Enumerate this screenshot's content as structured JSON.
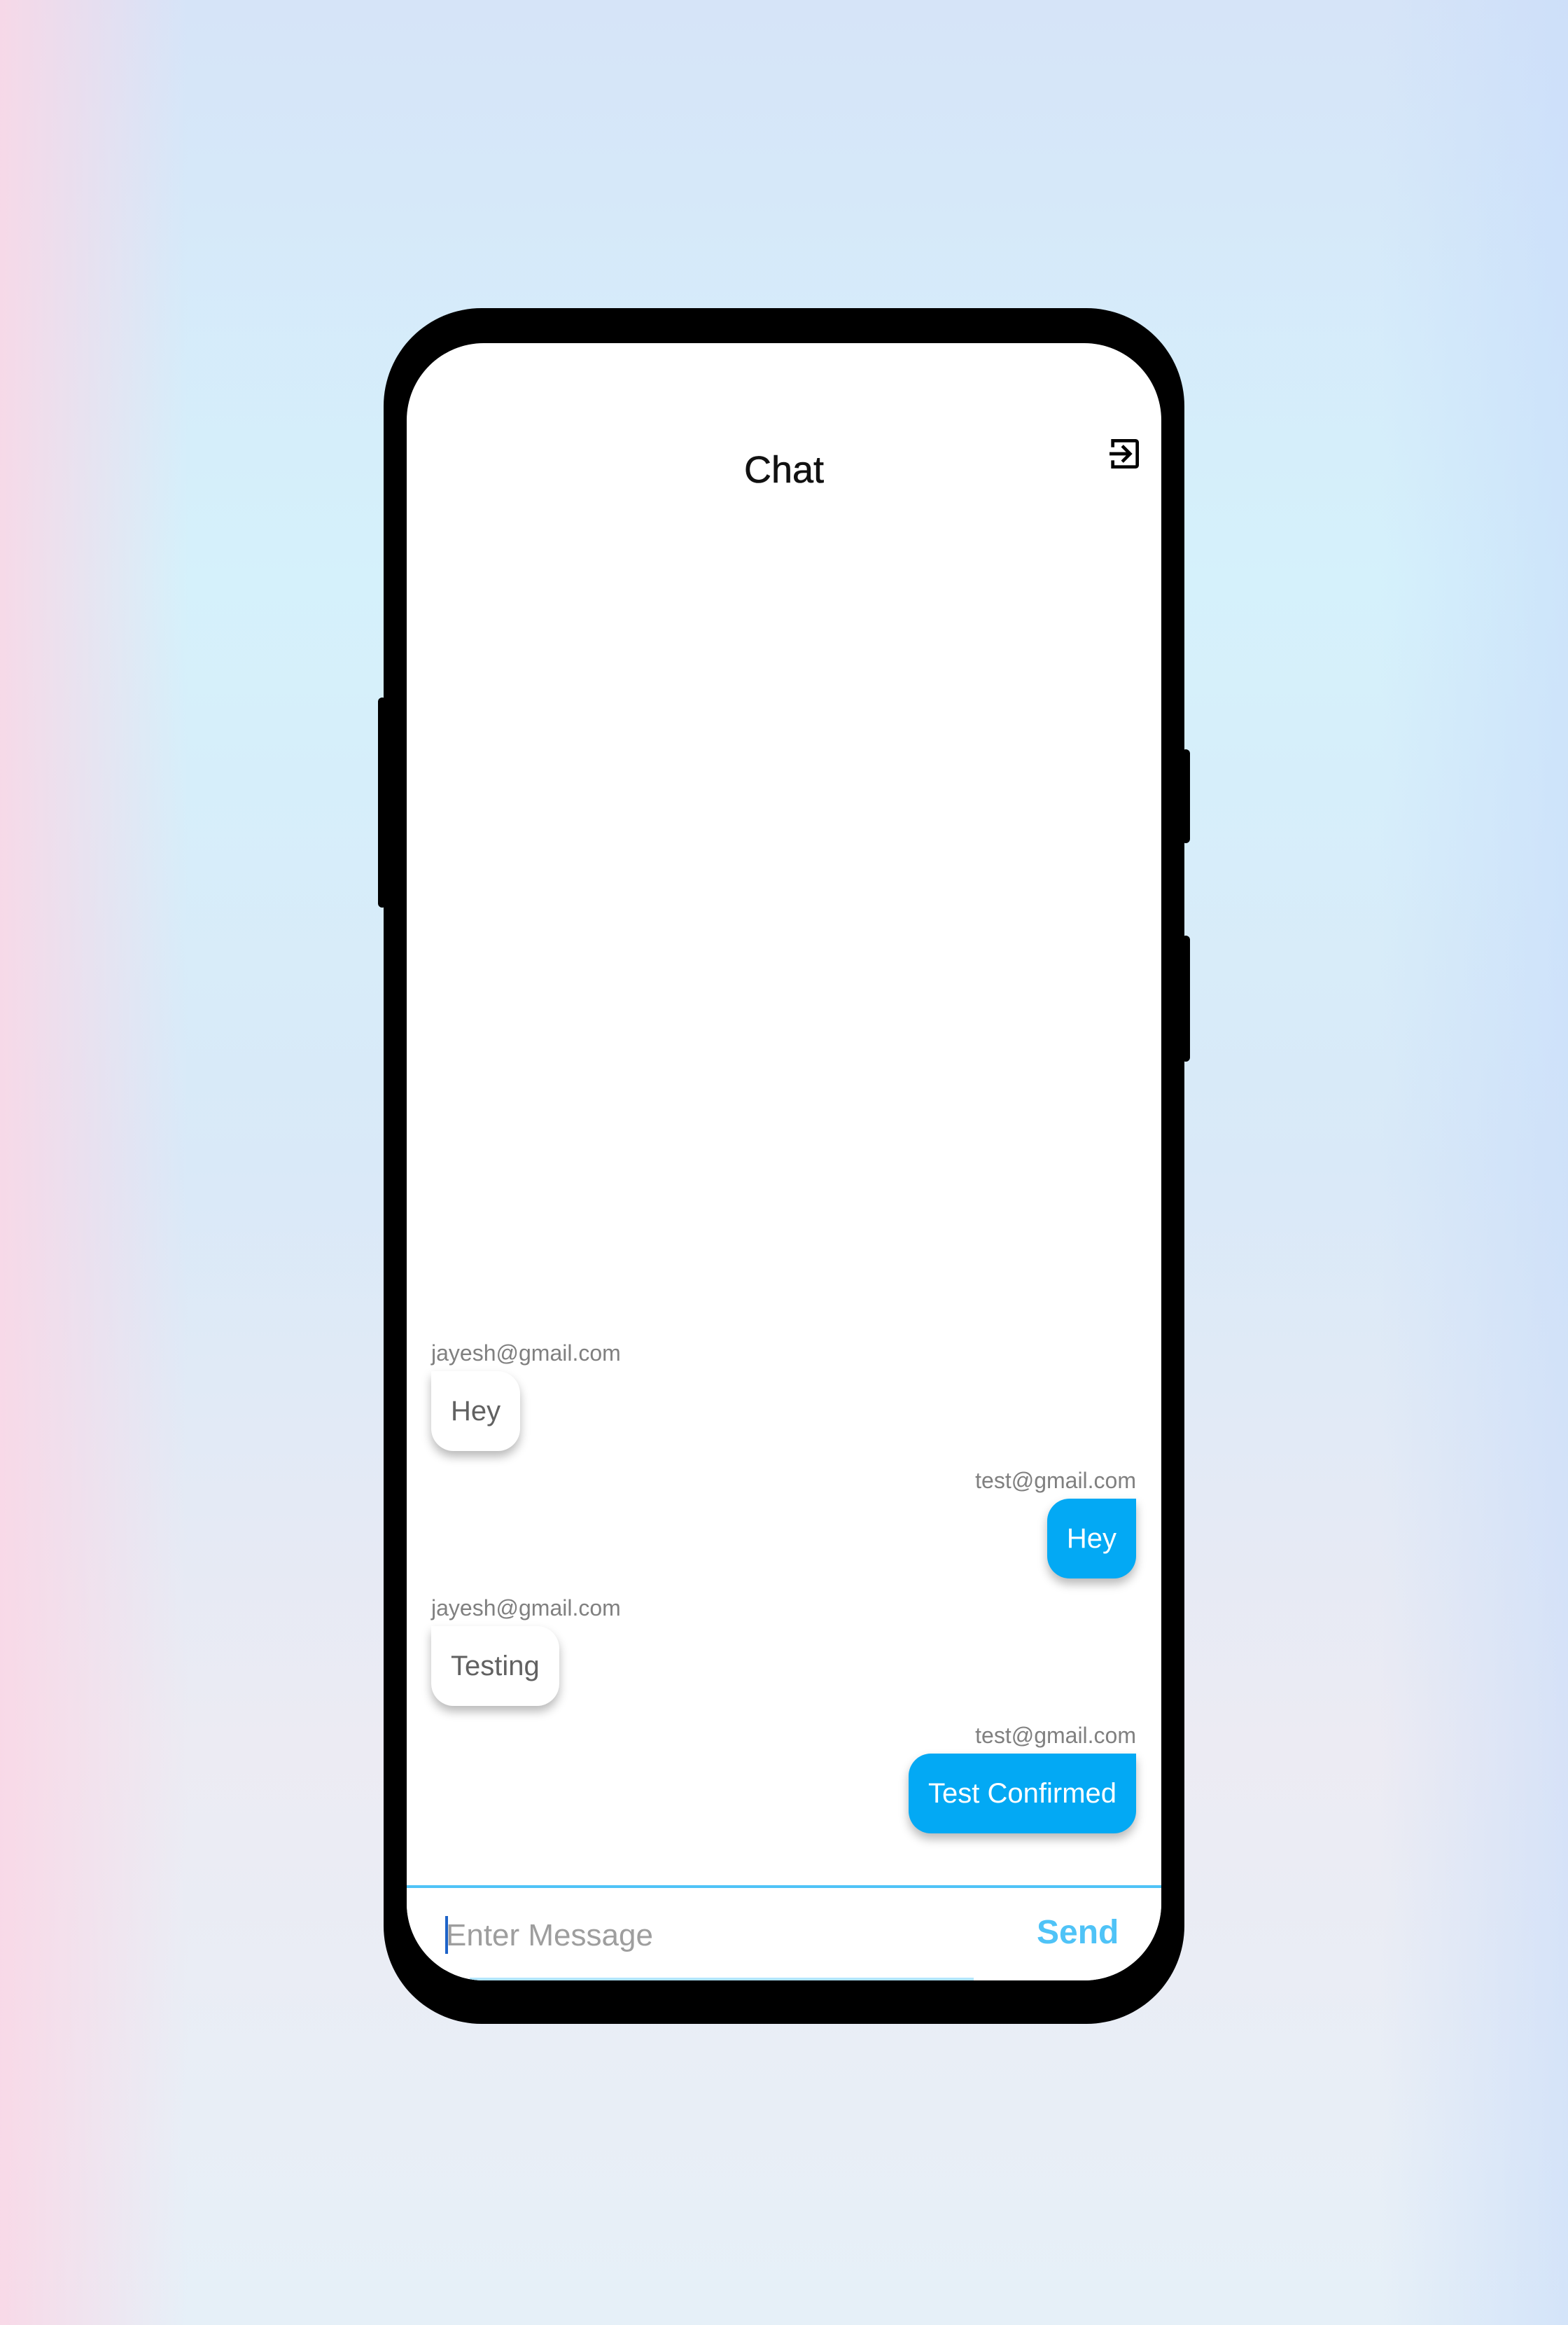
{
  "app": {
    "title": "Chat",
    "logout_icon": "logout-icon"
  },
  "messages": [
    {
      "sender": "jayesh@gmail.com",
      "text": "Hey",
      "side": "left"
    },
    {
      "sender": "test@gmail.com",
      "text": "Hey",
      "side": "right"
    },
    {
      "sender": "jayesh@gmail.com",
      "text": "Testing",
      "side": "left"
    },
    {
      "sender": "test@gmail.com",
      "text": "Test Confirmed",
      "side": "right"
    }
  ],
  "composer": {
    "placeholder": "Enter Message",
    "value": "",
    "send_label": "Send"
  },
  "colors": {
    "accent": "#03a9f4",
    "send": "#4fc3f7",
    "received_bubble": "#ffffff",
    "sent_bubble": "#03a9f4"
  }
}
